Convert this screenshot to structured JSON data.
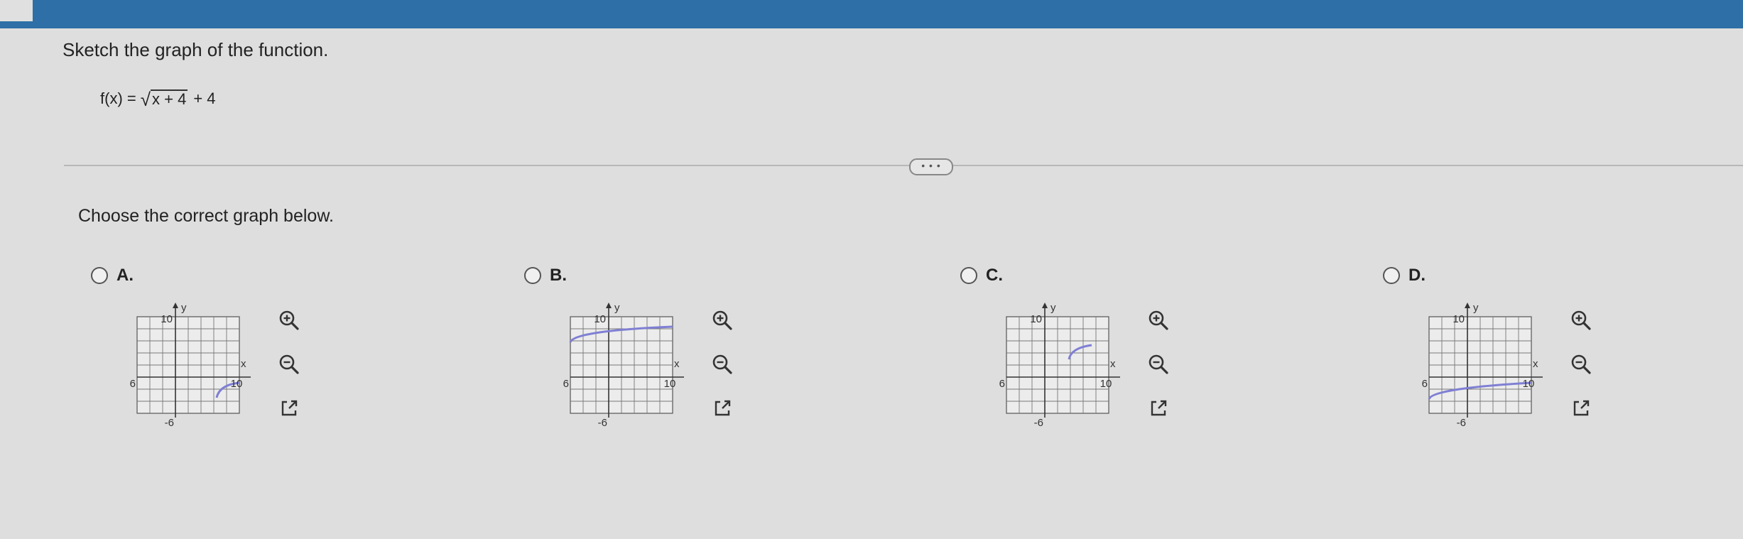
{
  "question": {
    "text": "Sketch the graph of the function."
  },
  "formula": {
    "lhs": "f(x) =",
    "radical": "√",
    "radicand": "x + 4",
    "tail": "+ 4"
  },
  "prompt": "Choose the correct graph below.",
  "more_button": {
    "label": "• • •"
  },
  "graph_labels": {
    "y": "y",
    "x": "x",
    "y_top": "10",
    "x_left": "-6",
    "x_right": "10",
    "y_bottom": "-6"
  },
  "colors": {
    "curve": "#7f7fd4",
    "top_bar": "#2d6fa6",
    "grid": "#666666"
  },
  "options": [
    {
      "label": "A.",
      "curve": "lower-right"
    },
    {
      "label": "B.",
      "curve": "upper-left"
    },
    {
      "label": "C.",
      "curve": "upper-right"
    },
    {
      "label": "D.",
      "curve": "lower-left"
    }
  ],
  "tools": [
    {
      "icon": "zoom-in-icon"
    },
    {
      "icon": "zoom-out-icon"
    },
    {
      "icon": "open-new-window-icon"
    }
  ]
}
